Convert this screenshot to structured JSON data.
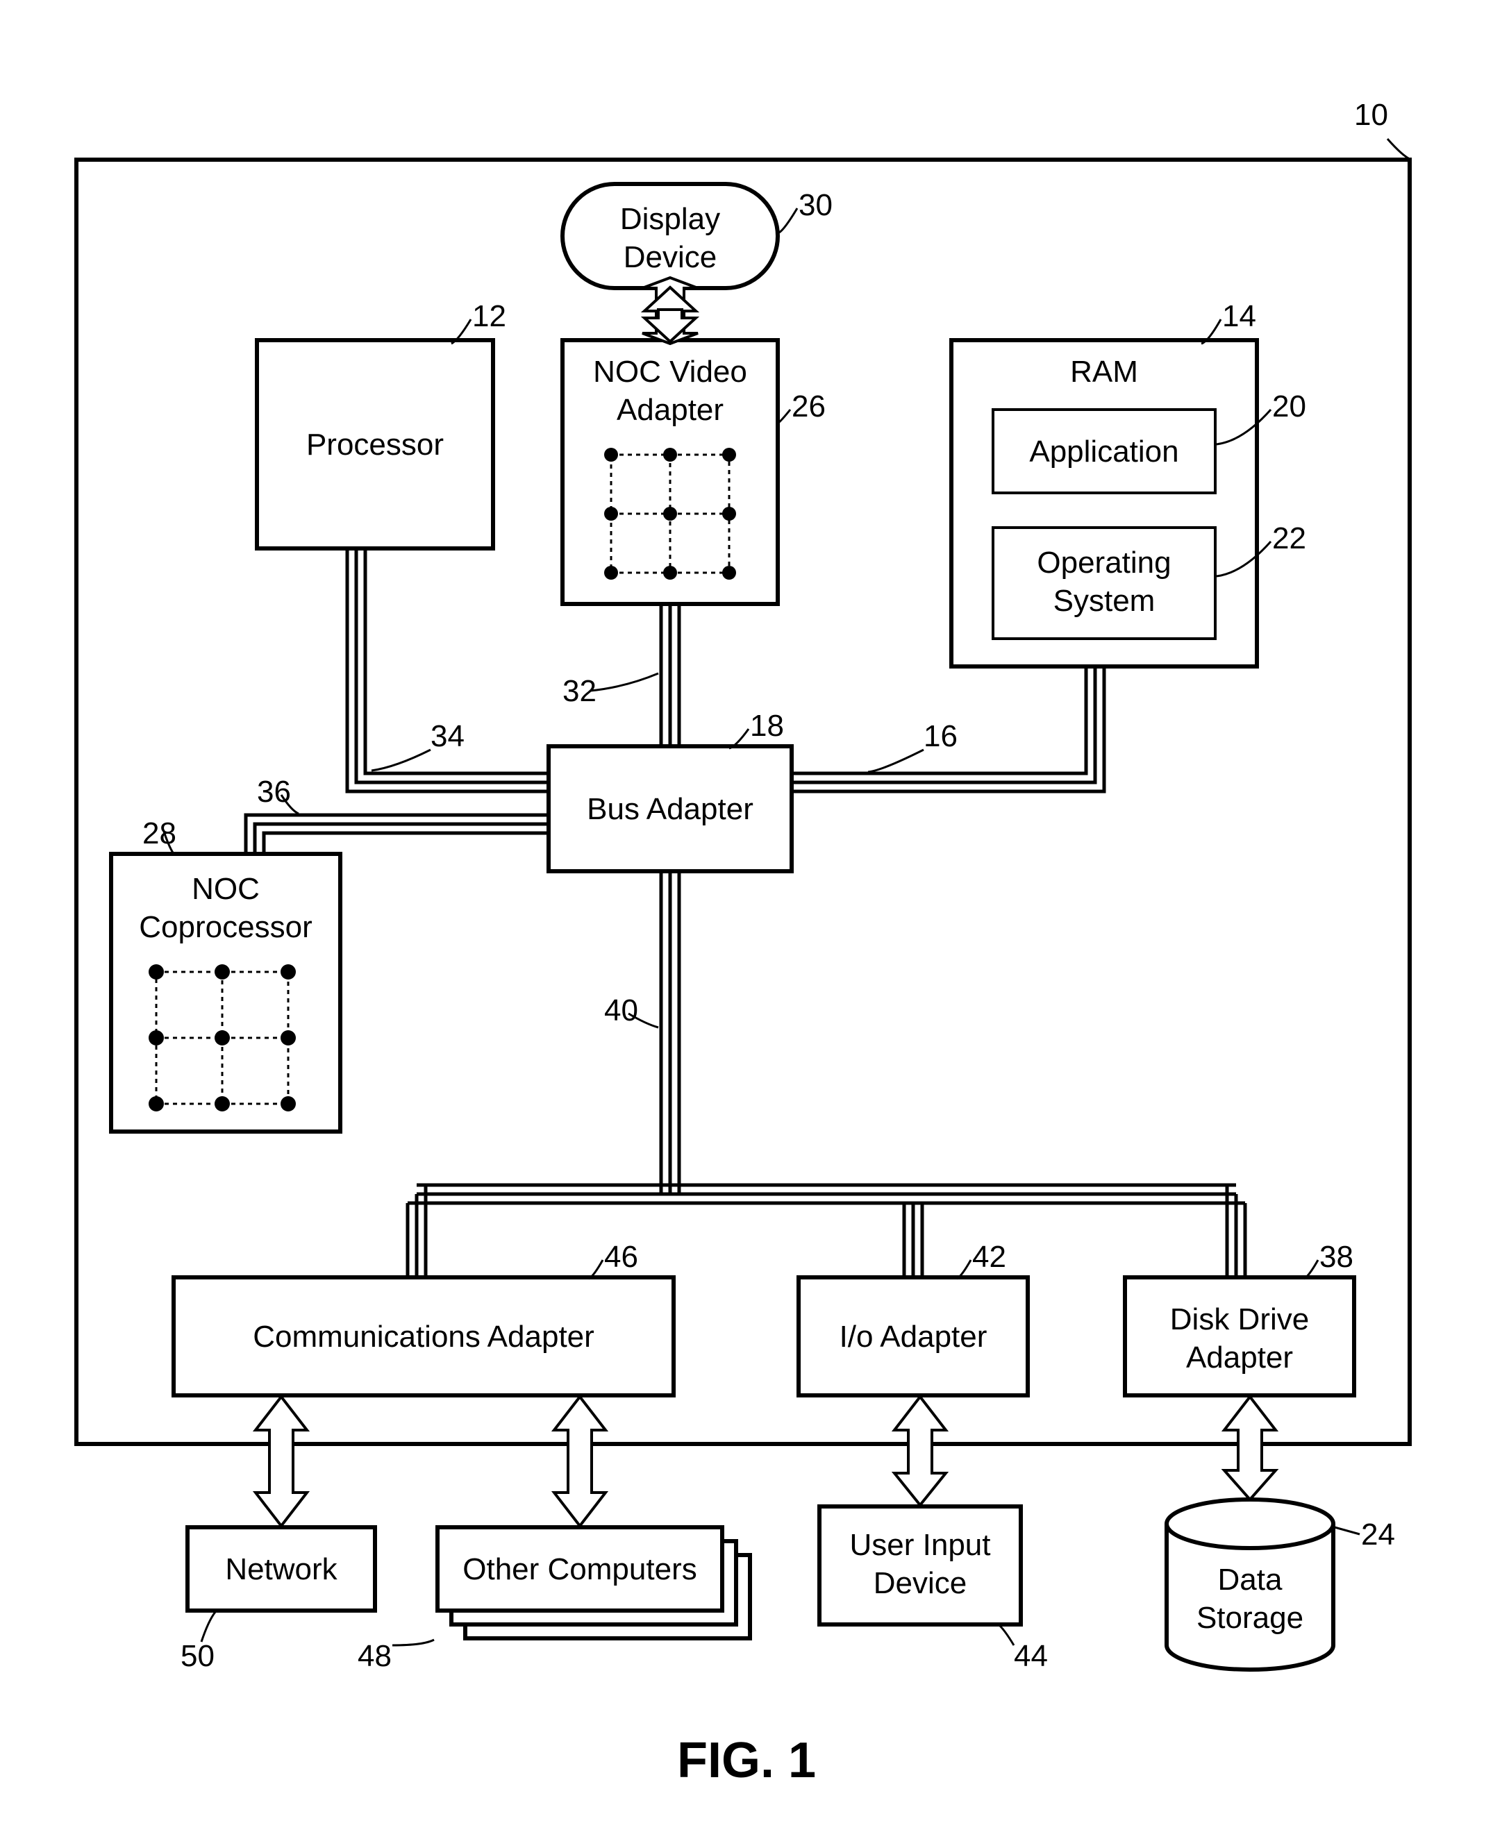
{
  "figure_caption": "FIG. 1",
  "outer_ref": "10",
  "blocks": {
    "processor": {
      "label": "Processor",
      "ref": "12"
    },
    "noc_video": {
      "label1": "NOC Video",
      "label2": "Adapter",
      "ref": "26"
    },
    "display": {
      "label1": "Display",
      "label2": "Device",
      "ref": "30"
    },
    "ram": {
      "label": "RAM",
      "ref": "14"
    },
    "application": {
      "label": "Application",
      "ref": "20"
    },
    "os": {
      "label1": "Operating",
      "label2": "System",
      "ref": "22"
    },
    "bus_adapter": {
      "label": "Bus Adapter",
      "ref": "18"
    },
    "noc_co": {
      "label1": "NOC",
      "label2": "Coprocessor",
      "ref": "28"
    },
    "comms": {
      "label": "Communications Adapter",
      "ref": "46"
    },
    "io": {
      "label": "I/o Adapter",
      "ref": "42"
    },
    "disk": {
      "label1": "Disk Drive",
      "label2": "Adapter",
      "ref": "38"
    },
    "network": {
      "label": "Network",
      "ref": "50"
    },
    "other": {
      "label": "Other Computers",
      "ref": "48"
    },
    "uid": {
      "label1": "User Input",
      "label2": "Device",
      "ref": "44"
    },
    "storage": {
      "label1": "Data",
      "label2": "Storage",
      "ref": "24"
    }
  },
  "buses": {
    "video_display": null,
    "video_bus": "32",
    "proc_bus": "34",
    "ram_bus": "16",
    "co_bus": "36",
    "expansion": "40"
  }
}
